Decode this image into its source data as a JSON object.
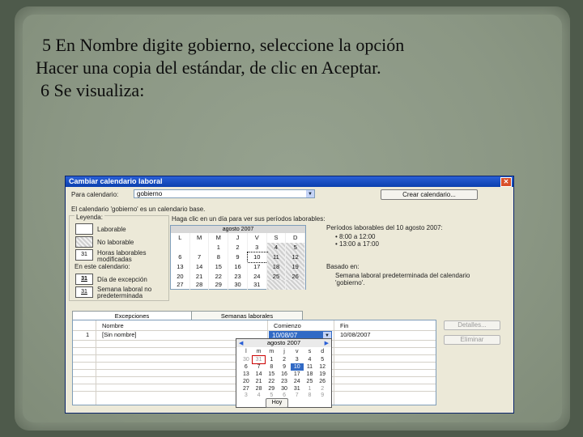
{
  "slide": {
    "line1": "5  En Nombre digite gobierno, seleccione la opción",
    "line2": "Hacer una copia del estándar, de clic en Aceptar.",
    "line3": "6  Se visualiza:"
  },
  "dialog": {
    "title": "Cambiar calendario laboral",
    "para_label": "Para calendario:",
    "para_value": "gobierno",
    "create_button": "Crear calendario...",
    "base_note": "El calendario 'gobierno' es un calendario base.",
    "legend_title": "Leyenda:",
    "legend": [
      {
        "label": "Laborable",
        "glyph": ""
      },
      {
        "label": "No laborable",
        "glyph": ""
      },
      {
        "label": "Horas laborables modificadas",
        "glyph": "31"
      }
    ],
    "on_calendar_title": "En este calendario:",
    "on_calendar": [
      {
        "label": "Día de excepción",
        "glyph": "31"
      },
      {
        "label": "Semana laboral no predeterminada",
        "glyph": "31"
      }
    ],
    "click_note": "Haga clic en un día para ver sus períodos laborables:",
    "month": "agosto 2007",
    "weekdays": [
      "L",
      "M",
      "M",
      "J",
      "V",
      "S",
      "D"
    ],
    "weeks": [
      [
        "",
        "",
        "1",
        "2",
        "3",
        "4",
        "5"
      ],
      [
        "6",
        "7",
        "8",
        "9",
        "10",
        "11",
        "12"
      ],
      [
        "13",
        "14",
        "15",
        "16",
        "17",
        "18",
        "19"
      ],
      [
        "20",
        "21",
        "22",
        "23",
        "24",
        "25",
        "26"
      ],
      [
        "27",
        "28",
        "29",
        "30",
        "31",
        "",
        ""
      ]
    ],
    "periods_title": "Períodos laborables del 10 agosto 2007:",
    "periods": [
      "• 8:00 a 12:00",
      "• 13:00 a 17:00"
    ],
    "based_title": "Basado en:",
    "based_text": "Semana laboral predeterminada del calendario 'gobierno'.",
    "tabs": [
      "Excepciones",
      "Semanas laborales"
    ],
    "table": {
      "headers": [
        "Nombre",
        "Comienzo",
        "Fin"
      ],
      "row_num": "1",
      "row_name": "[Sin nombre]",
      "row_start": "10/08/07",
      "row_end": "10/08/2007"
    },
    "details_button": "Detalles...",
    "delete_button": "Eliminar"
  },
  "popup": {
    "month": "agosto 2007",
    "weekdays": [
      "l",
      "m",
      "m",
      "j",
      "v",
      "s",
      "d"
    ],
    "weeks": [
      [
        "30",
        "31",
        "1",
        "2",
        "3",
        "4",
        "5"
      ],
      [
        "6",
        "7",
        "8",
        "9",
        "10",
        "11",
        "12"
      ],
      [
        "13",
        "14",
        "15",
        "16",
        "17",
        "18",
        "19"
      ],
      [
        "20",
        "21",
        "22",
        "23",
        "24",
        "25",
        "26"
      ],
      [
        "27",
        "28",
        "29",
        "30",
        "31",
        "1",
        "2"
      ],
      [
        "3",
        "4",
        "5",
        "6",
        "7",
        "8",
        "9"
      ]
    ],
    "today_button": "Hoy"
  }
}
